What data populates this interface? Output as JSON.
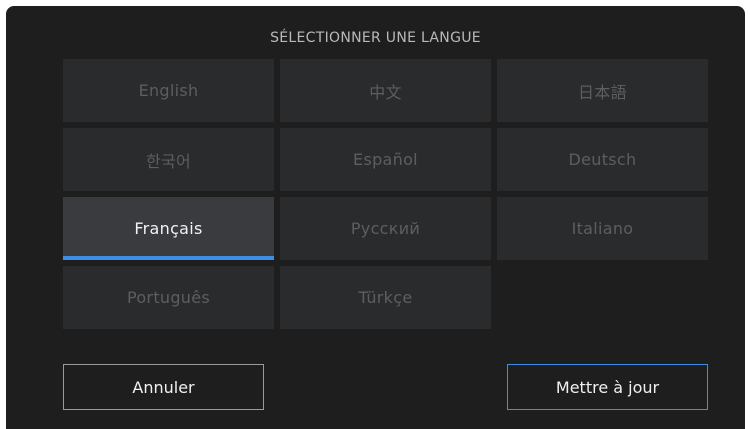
{
  "dialog": {
    "title": "SÉLECTIONNER UNE LANGUE",
    "languages": [
      {
        "label": "English",
        "selected": false
      },
      {
        "label": "中文",
        "selected": false
      },
      {
        "label": "日本語",
        "selected": false
      },
      {
        "label": "한국어",
        "selected": false
      },
      {
        "label": "Español",
        "selected": false
      },
      {
        "label": "Deutsch",
        "selected": false
      },
      {
        "label": "Français",
        "selected": true
      },
      {
        "label": "Русский",
        "selected": false
      },
      {
        "label": "Italiano",
        "selected": false
      },
      {
        "label": "Português",
        "selected": false
      },
      {
        "label": "Türkçe",
        "selected": false
      }
    ],
    "cancel_label": "Annuler",
    "update_label": "Mettre à jour"
  },
  "colors": {
    "background": "#1e1e1f",
    "button": "#2a2b2d",
    "button_selected": "#3a3b3e",
    "accent": "#3d8ee6"
  }
}
